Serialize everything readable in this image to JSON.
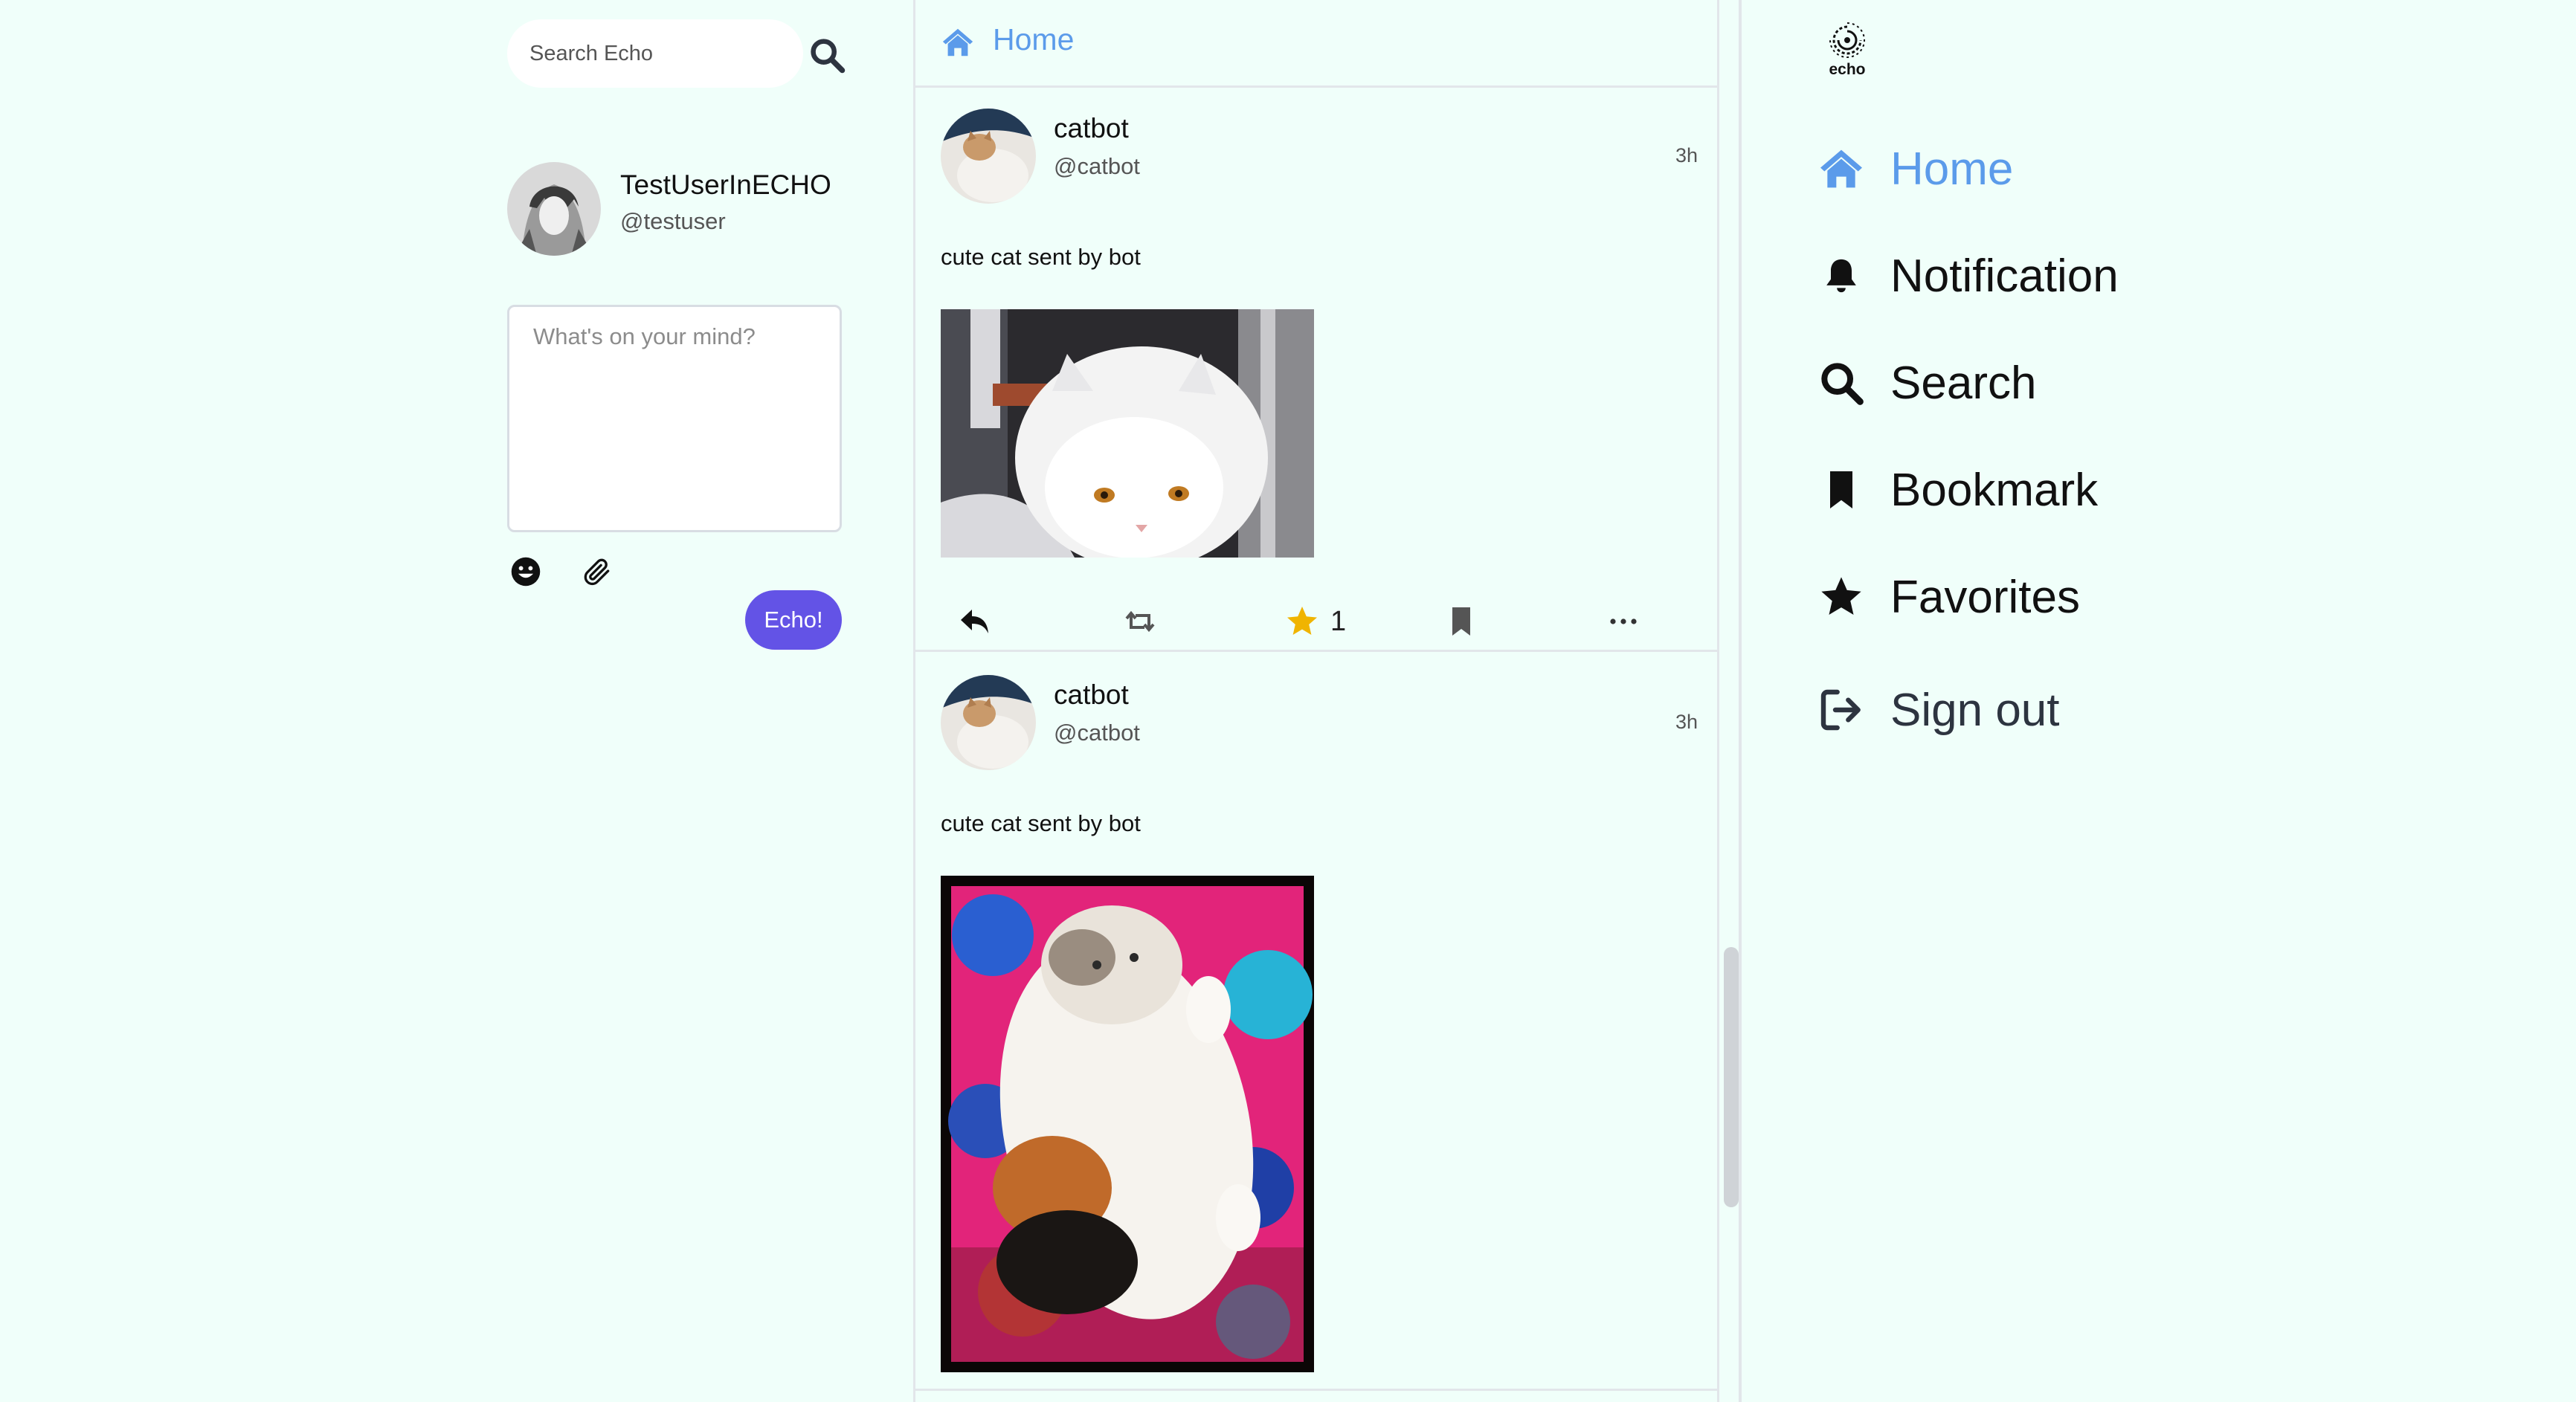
{
  "search": {
    "placeholder": "Search Echo"
  },
  "user": {
    "name": "TestUserInECHO",
    "handle": "@testuser"
  },
  "composer": {
    "placeholder": "What's on your mind?",
    "submit_label": "Echo!"
  },
  "feed": {
    "title": "Home",
    "posts": [
      {
        "author": "catbot",
        "handle": "@catbot",
        "time": "3h",
        "text": "cute cat sent by bot",
        "favorites": "1"
      },
      {
        "author": "catbot",
        "handle": "@catbot",
        "time": "3h",
        "text": "cute cat sent by bot"
      }
    ]
  },
  "nav": {
    "logo_text": "echo",
    "items": [
      {
        "label": "Home",
        "icon": "home-icon"
      },
      {
        "label": "Notification",
        "icon": "bell-icon"
      },
      {
        "label": "Search",
        "icon": "search-icon"
      },
      {
        "label": "Bookmark",
        "icon": "bookmark-icon"
      },
      {
        "label": "Favorites",
        "icon": "star-icon"
      },
      {
        "label": "Sign out",
        "icon": "sign-out-icon"
      }
    ]
  },
  "colors": {
    "accent": "#5b9bea",
    "button": "#6353e6",
    "star": "#f0b400",
    "background": "#f0fffa"
  }
}
